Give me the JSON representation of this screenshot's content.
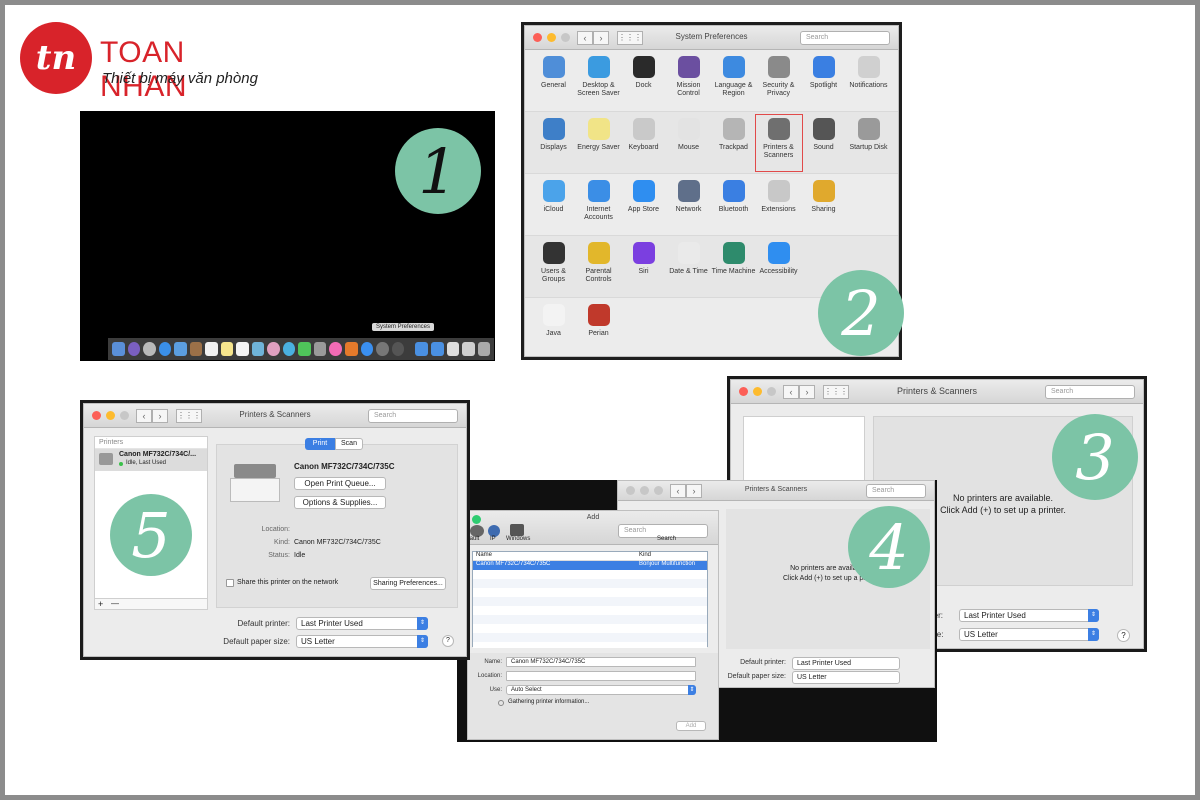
{
  "logo": {
    "initials": "tn",
    "name": "TOAN NHAN",
    "tagline": "Thiết bị máy văn phòng"
  },
  "steps": [
    "1",
    "2",
    "3",
    "4",
    "5"
  ],
  "panel1": {
    "dock_tooltip": "System Preferences"
  },
  "panel2": {
    "title": "System Preferences",
    "search_placeholder": "Search",
    "rows": [
      [
        {
          "label": "General",
          "icon": "general-icon",
          "color": "#4f8ed8"
        },
        {
          "label": "Desktop & Screen Saver",
          "icon": "desktop-icon",
          "color": "#3b9be0"
        },
        {
          "label": "Dock",
          "icon": "dock-icon",
          "color": "#2a2a2a"
        },
        {
          "label": "Mission Control",
          "icon": "mission-control-icon",
          "color": "#6b4fa0"
        },
        {
          "label": "Language & Region",
          "icon": "globe-flag-icon",
          "color": "#3d8ae0"
        },
        {
          "label": "Security & Privacy",
          "icon": "house-lock-icon",
          "color": "#8a8a8a"
        },
        {
          "label": "Spotlight",
          "icon": "spotlight-icon",
          "color": "#3a7fe2"
        },
        {
          "label": "Notifications",
          "icon": "notifications-icon",
          "color": "#d0d0d0"
        }
      ],
      [
        {
          "label": "Displays",
          "icon": "display-icon",
          "color": "#3e7fc8"
        },
        {
          "label": "Energy Saver",
          "icon": "bulb-icon",
          "color": "#f1e487"
        },
        {
          "label": "Keyboard",
          "icon": "keyboard-icon",
          "color": "#c9c9c9"
        },
        {
          "label": "Mouse",
          "icon": "mouse-icon",
          "color": "#e3e3e3"
        },
        {
          "label": "Trackpad",
          "icon": "trackpad-icon",
          "color": "#b5b5b5"
        },
        {
          "label": "Printers & Scanners",
          "icon": "printer-icon",
          "color": "#6f6f6f"
        },
        {
          "label": "Sound",
          "icon": "speaker-icon",
          "color": "#555"
        },
        {
          "label": "Startup Disk",
          "icon": "disk-icon",
          "color": "#9a9a9a"
        }
      ],
      [
        {
          "label": "iCloud",
          "icon": "cloud-icon",
          "color": "#4ba3ea"
        },
        {
          "label": "Internet Accounts",
          "icon": "at-icon",
          "color": "#3b8ee6"
        },
        {
          "label": "App Store",
          "icon": "app-store-icon",
          "color": "#2f8ef0"
        },
        {
          "label": "Network",
          "icon": "network-icon",
          "color": "#5f6f8a"
        },
        {
          "label": "Bluetooth",
          "icon": "bluetooth-icon",
          "color": "#3a7fe2"
        },
        {
          "label": "Extensions",
          "icon": "puzzle-icon",
          "color": "#c8c8c8"
        },
        {
          "label": "Sharing",
          "icon": "sharing-icon",
          "color": "#e0a92d"
        }
      ],
      [
        {
          "label": "Users & Groups",
          "icon": "users-icon",
          "color": "#333"
        },
        {
          "label": "Parental Controls",
          "icon": "parental-icon",
          "color": "#e2b72b"
        },
        {
          "label": "Siri",
          "icon": "siri-icon",
          "color": "#7b3fe0"
        },
        {
          "label": "Date & Time",
          "icon": "clock-icon",
          "color": "#eaeaea"
        },
        {
          "label": "Time Machine",
          "icon": "time-machine-icon",
          "color": "#2e8b6c"
        },
        {
          "label": "Accessibility",
          "icon": "accessibility-icon",
          "color": "#2f8ef0"
        }
      ],
      [
        {
          "label": "Java",
          "icon": "java-icon",
          "color": "#f3f3f3"
        },
        {
          "label": "Perian",
          "icon": "perian-icon",
          "color": "#c0392b"
        }
      ]
    ]
  },
  "panel3": {
    "title": "Printers & Scanners",
    "search_placeholder": "Search",
    "empty_line1": "No printers are available.",
    "empty_line2": "Click Add (+) to set up a printer.",
    "default_printer_label": "nter:",
    "default_printer_value": "Last Printer Used",
    "paper_label": "size:",
    "paper_value": "US Letter"
  },
  "panel4": {
    "back_title": "Printers & Scanners",
    "back_search": "Search",
    "back_empty1": "No printers are available",
    "back_empty2": "Click Add (+) to set up a print",
    "back_default_label": "Default printer:",
    "back_default_value": "Last Printer Used",
    "back_paper_label": "Default paper size:",
    "back_paper_value": "US Letter",
    "add_title": "Add",
    "add_search": "Search",
    "add_search_label": "Search",
    "tabs": [
      "fault",
      "IP",
      "Windows"
    ],
    "col_name": "Name",
    "col_kind": "Kind",
    "row_name": "Canon MF732C/734C/735C",
    "row_kind": "Bonjour Multifunction",
    "name_label": "Name:",
    "name_value": "Canon MF732C/734C/735C",
    "location_label": "Location:",
    "location_value": "",
    "use_label": "Use:",
    "use_value": "Auto Select",
    "gathering": "Gathering printer information...",
    "add_button": "Add"
  },
  "panel5": {
    "title": "Printers & Scanners",
    "search_placeholder": "Search",
    "list_header": "Printers",
    "printer_name": "Canon MF732C/734C/...",
    "printer_status": "Idle, Last Used",
    "tab_print": "Print",
    "tab_scan": "Scan",
    "detail_name": "Canon MF732C/734C/735C",
    "open_queue": "Open Print Queue...",
    "options": "Options & Supplies...",
    "location_label": "Location:",
    "kind_label": "Kind:",
    "kind_value": "Canon MF732C/734C/735C",
    "status_label": "Status:",
    "status_value": "Idle",
    "share_label": "Share this printer on the network",
    "sharing_prefs": "Sharing Preferences...",
    "default_printer_label": "Default printer:",
    "default_printer_value": "Last Printer Used",
    "paper_label": "Default paper size:",
    "paper_value": "US Letter",
    "add": "+",
    "remove": "—",
    "help": "?"
  },
  "colors": {
    "brand_red": "#d8232a",
    "step_green": "#7cc4a6",
    "selection_blue": "#3c7fe3"
  }
}
